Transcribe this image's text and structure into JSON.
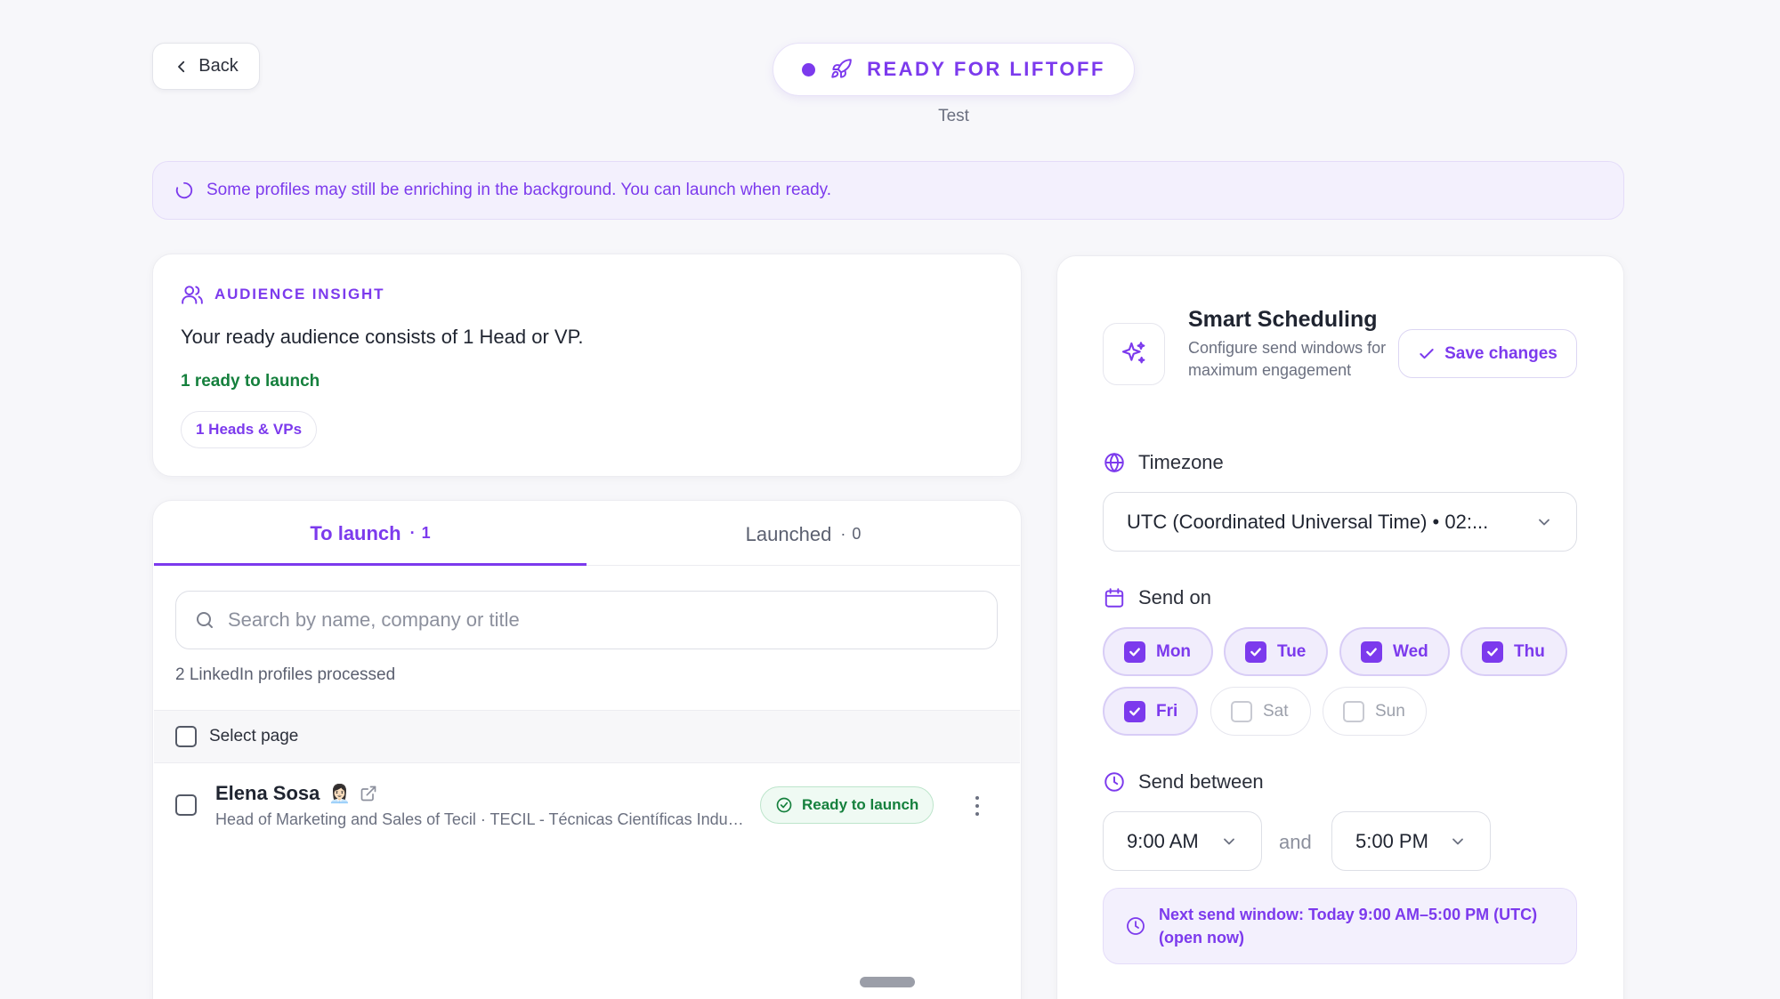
{
  "header": {
    "back_label": "Back",
    "status_label": "READY FOR LIFTOFF",
    "campaign_name": "Test"
  },
  "banner": {
    "text": "Some profiles may still be enriching in the background. You can launch when ready."
  },
  "insight": {
    "title": "AUDIENCE INSIGHT",
    "text": "Your ready audience consists of 1 Head or VP.",
    "ready_count": "1 ready to launch",
    "segment_chip": "1 Heads & VPs"
  },
  "tabs": [
    {
      "label": "To launch",
      "count": "1"
    },
    {
      "label": "Launched",
      "count": "0"
    }
  ],
  "search": {
    "placeholder": "Search by name, company or title",
    "value": ""
  },
  "list": {
    "processed_text": "2 LinkedIn profiles processed",
    "select_page_label": "Select page",
    "rows": [
      {
        "name": "Elena Sosa",
        "emoji": "👩🏻‍💼",
        "title": "Head of Marketing and Sales of Tecil · TECIL - Técnicas Científicas Industriales",
        "status": "Ready to launch"
      }
    ]
  },
  "scheduling": {
    "title": "Smart Scheduling",
    "subtitle": "Configure send windows for maximum engagement",
    "save_label": "Save changes",
    "timezone_label": "Timezone",
    "timezone_value": "UTC (Coordinated Universal Time) • 02:...",
    "send_on_label": "Send on",
    "days": [
      {
        "label": "Mon",
        "checked": true
      },
      {
        "label": "Tue",
        "checked": true
      },
      {
        "label": "Wed",
        "checked": true
      },
      {
        "label": "Thu",
        "checked": true
      },
      {
        "label": "Fri",
        "checked": true
      },
      {
        "label": "Sat",
        "checked": false
      },
      {
        "label": "Sun",
        "checked": false
      }
    ],
    "send_between_label": "Send between",
    "start_time": "9:00 AM",
    "and_label": "and",
    "end_time": "5:00 PM",
    "next_window": "Next send window: Today 9:00 AM–5:00 PM (UTC) (open now)"
  },
  "colors": {
    "accent": "#7c3aed",
    "success": "#15803d",
    "background": "#f7f7fa"
  }
}
